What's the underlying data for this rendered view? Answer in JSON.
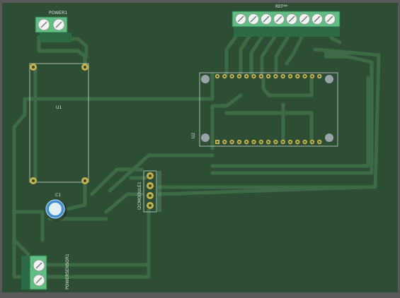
{
  "colors": {
    "background": "#595959",
    "board": "#2d4d35",
    "trace": "#3f6a48",
    "silkscreen": "#d8e8dc",
    "terminal_body": "#5fbf82",
    "pad_gold": "#c8b24a",
    "mount_hole": "#9aa3a8",
    "capacitor_blue": "#3f8fd6"
  },
  "components": {
    "power": {
      "ref": "POWER1",
      "icon": "screw-terminal-2pin"
    },
    "ref_terminal": {
      "ref": "REF**",
      "icon": "screw-terminal-8pin"
    },
    "u1": {
      "ref": "U1",
      "icon": "module-outline"
    },
    "u2": {
      "ref": "U2",
      "icon": "module-header-2x15"
    },
    "c1": {
      "ref": "C1",
      "icon": "electrolytic-capacitor"
    },
    "i2c": {
      "ref": "I2CMODULE1",
      "icon": "pin-header-4pin"
    },
    "power_sensor": {
      "ref": "POWERSENSOR1",
      "icon": "screw-terminal-2pin"
    }
  }
}
